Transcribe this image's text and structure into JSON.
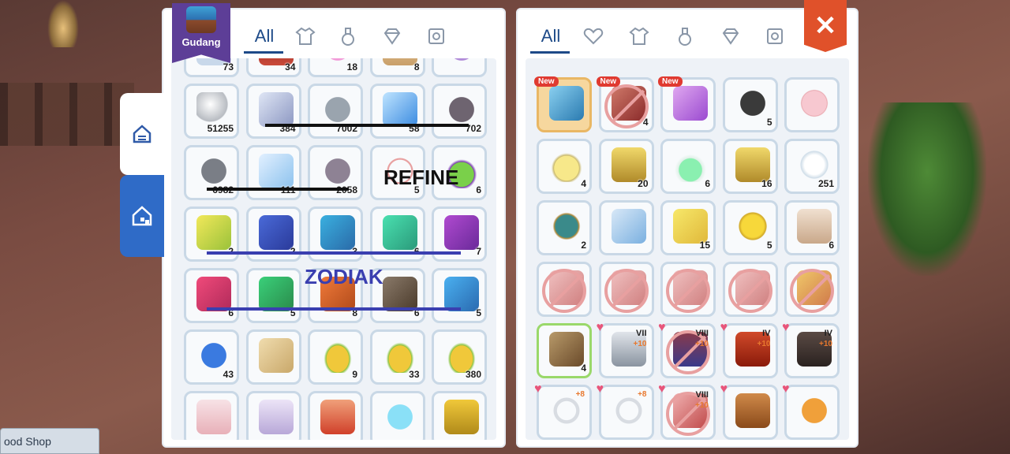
{
  "storage": {
    "title": "Gudang",
    "tabs": {
      "all_label": "All"
    },
    "items": [
      {
        "count": "73",
        "icon": "emblem-icon"
      },
      {
        "count": "34",
        "icon": "red-card-icon"
      },
      {
        "count": "18",
        "icon": "pink-petal-icon"
      },
      {
        "count": "8",
        "icon": "claw-icon"
      },
      {
        "count": "",
        "icon": "purple-item-icon"
      },
      {
        "count": "51255",
        "icon": "pearl-icon"
      },
      {
        "count": "384",
        "icon": "crystal-ore-icon"
      },
      {
        "count": "7002",
        "icon": "grey-stone-icon"
      },
      {
        "count": "58",
        "icon": "blue-crystal-icon"
      },
      {
        "count": "702",
        "icon": "dark-stone-icon"
      },
      {
        "count": "6982",
        "icon": "rock-icon"
      },
      {
        "count": "111",
        "icon": "ice-crystal-icon"
      },
      {
        "count": "2058",
        "icon": "purple-rock-icon"
      },
      {
        "count": "5",
        "icon": "necklace-icon"
      },
      {
        "count": "6",
        "icon": "potion-icon"
      },
      {
        "count": "2",
        "icon": "zodiac-pisces-icon"
      },
      {
        "count": "2",
        "icon": "zodiac-aquarius-icon"
      },
      {
        "count": "3",
        "icon": "zodiac-capricorn-icon"
      },
      {
        "count": "6",
        "icon": "zodiac-sagittarius-icon"
      },
      {
        "count": "7",
        "icon": "zodiac-scorpio-icon"
      },
      {
        "count": "6",
        "icon": "zodiac-leo-icon"
      },
      {
        "count": "5",
        "icon": "zodiac-virgo-icon"
      },
      {
        "count": "8",
        "icon": "zodiac-libra-icon"
      },
      {
        "count": "6",
        "icon": "zodiac-cancer-icon"
      },
      {
        "count": "5",
        "icon": "zodiac-gemini-icon"
      },
      {
        "count": "43",
        "icon": "blue-star-icon"
      },
      {
        "count": "",
        "icon": "scroll-icon"
      },
      {
        "count": "9",
        "icon": "fruit-icon"
      },
      {
        "count": "33",
        "icon": "fruit-icon"
      },
      {
        "count": "380",
        "icon": "fruit-icon"
      },
      {
        "count": "",
        "icon": "pink-crystal-icon"
      },
      {
        "count": "",
        "icon": "lavender-crystal-icon"
      },
      {
        "count": "",
        "icon": "red-gem-icon"
      },
      {
        "count": "",
        "icon": "blue-orb-icon"
      },
      {
        "count": "",
        "icon": "gold-box-icon"
      }
    ]
  },
  "bag": {
    "tabs": {
      "all_label": "All"
    },
    "close_label": "✕",
    "new_label": "New",
    "items": [
      {
        "count": "",
        "icon": "blue-bow-icon",
        "new": true,
        "highlight": true
      },
      {
        "count": "4",
        "icon": "coral-icon",
        "new": true,
        "prohibited": true
      },
      {
        "count": "",
        "icon": "butterfly-wings-icon",
        "new": true
      },
      {
        "count": "5",
        "icon": "coal-icon"
      },
      {
        "count": "",
        "icon": "dish-icon"
      },
      {
        "count": "4",
        "icon": "yellow-potion-icon"
      },
      {
        "count": "20",
        "icon": "gold-flask-icon"
      },
      {
        "count": "6",
        "icon": "green-flask-icon"
      },
      {
        "count": "16",
        "icon": "gold-flask-icon"
      },
      {
        "count": "251",
        "icon": "cotton-icon"
      },
      {
        "count": "2",
        "icon": "egg-icon"
      },
      {
        "count": "",
        "icon": "pet-card-icon"
      },
      {
        "count": "15",
        "icon": "ticket-icon"
      },
      {
        "count": "5",
        "icon": "gold-nugget-icon"
      },
      {
        "count": "6",
        "icon": "gift-bag-icon"
      },
      {
        "count": "",
        "icon": "weapon-icon",
        "prohibited": true
      },
      {
        "count": "",
        "icon": "weapon-icon",
        "prohibited": true
      },
      {
        "count": "",
        "icon": "weapon-icon",
        "prohibited": true
      },
      {
        "count": "",
        "icon": "weapon-icon",
        "prohibited": true
      },
      {
        "count": "",
        "icon": "shield-icon",
        "prohibited": true
      },
      {
        "count": "4",
        "icon": "eagle-icon",
        "green": true
      },
      {
        "count": "",
        "icon": "armor-icon",
        "heart": true,
        "roman": "VII",
        "plus": "+10"
      },
      {
        "count": "",
        "icon": "robe-icon",
        "heart": true,
        "roman": "VIII",
        "plus": "+10",
        "prohibited": true
      },
      {
        "count": "",
        "icon": "cape-icon",
        "heart": true,
        "roman": "IV",
        "plus": "+10"
      },
      {
        "count": "",
        "icon": "boots-icon",
        "heart": true,
        "roman": "IV",
        "plus": "+10"
      },
      {
        "count": "",
        "icon": "ring-icon",
        "heart": true,
        "plus": "+8"
      },
      {
        "count": "",
        "icon": "ring-icon",
        "heart": true,
        "plus": "+8"
      },
      {
        "count": "",
        "icon": "staff-icon",
        "heart": true,
        "roman": "VIII",
        "plus": "+10",
        "prohibited": true
      },
      {
        "count": "",
        "icon": "hat-icon",
        "heart": true
      },
      {
        "count": "",
        "icon": "pumpkin-icon",
        "heart": true
      }
    ]
  },
  "annotations": {
    "refine": "REFINE",
    "zodiak": "ZODIAK"
  },
  "bottom_left": {
    "label": "ood Shop"
  },
  "colors": {
    "accent": "#1d4a88",
    "close": "#e0512a",
    "gudang": "#5d3e97",
    "zodiak": "#3a3fb0"
  }
}
